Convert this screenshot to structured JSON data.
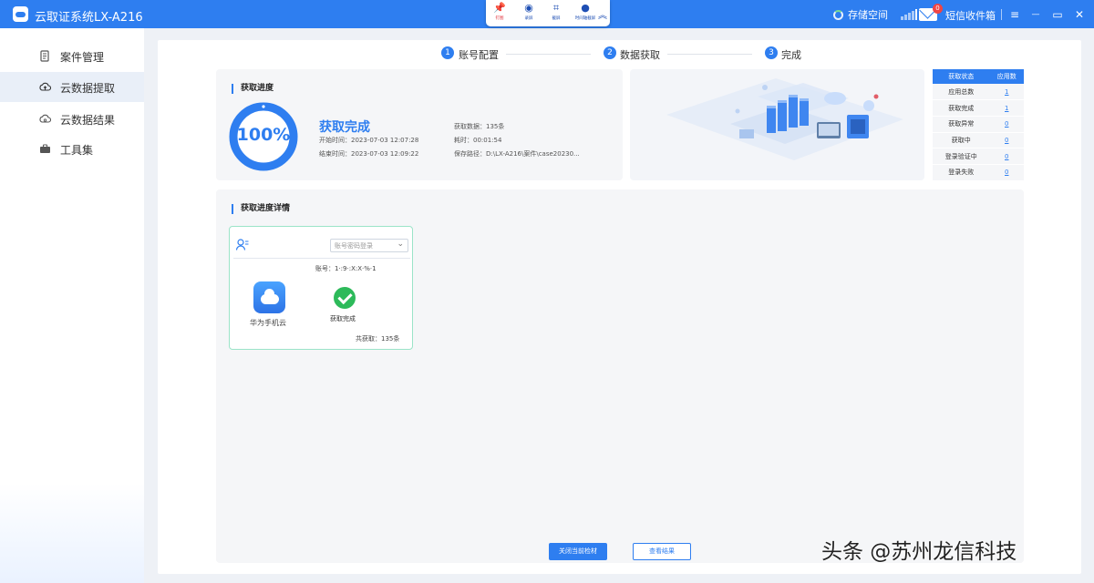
{
  "titlebar": {
    "app_title": "云取证系统LX-A216",
    "capture_tools": [
      {
        "label": "钉图",
        "icon": "pin-icon"
      },
      {
        "label": "录屏",
        "icon": "record-icon"
      },
      {
        "label": "截屏",
        "icon": "crop-icon"
      },
      {
        "label": "时间轴截屏",
        "icon": "clock-icon"
      }
    ],
    "storage_label": "存储空间",
    "sms_label": "短信收件箱",
    "sms_badge": "0",
    "menu_glyph": "≡",
    "minimize_glyph": "—",
    "maximize_glyph": "▭",
    "close_glyph": "✕"
  },
  "sidebar": {
    "items": [
      {
        "label": "案件管理",
        "icon": "document-icon",
        "active": false
      },
      {
        "label": "云数据提取",
        "icon": "cloud-upload-icon",
        "active": true
      },
      {
        "label": "云数据结果",
        "icon": "cloud-result-icon",
        "active": false
      },
      {
        "label": "工具集",
        "icon": "toolbox-icon",
        "active": false
      }
    ]
  },
  "steps": [
    {
      "num": "1",
      "label": "账号配置"
    },
    {
      "num": "2",
      "label": "数据获取"
    },
    {
      "num": "3",
      "label": "完成"
    }
  ],
  "progress": {
    "section_title": "获取进度",
    "percent": "100%",
    "percent_value": 1.0,
    "status": "获取完成",
    "start_time": "开始时间：2023-07-03 12:07:28",
    "end_time": "结束时间：2023-07-03 12:09:22",
    "data_count": "获取数据：135条",
    "duration": "耗时：00:01:54",
    "save_path": "保存路径：D:\\LX-A216\\案件\\case20230..."
  },
  "status_table": {
    "headers": [
      "获取状态",
      "应用数"
    ],
    "rows": [
      {
        "state": "应用总数",
        "count": "1"
      },
      {
        "state": "获取完成",
        "count": "1"
      },
      {
        "state": "获取异常",
        "count": "0"
      },
      {
        "state": "获取中",
        "count": "0"
      },
      {
        "state": "登录验证中",
        "count": "0"
      },
      {
        "state": "登录失败",
        "count": "0"
      }
    ]
  },
  "detail": {
    "section_title": "获取进度详情",
    "card": {
      "login_mode": "账号密码登录",
      "account": "账号：1·:9·:X:X·%·1",
      "app_name": "华为手机云",
      "status": "获取完成",
      "total": "共获取：135条"
    }
  },
  "buttons": {
    "close_case": "关闭当前检材",
    "view_result": "查看结果"
  },
  "watermark": "头条 @苏州龙信科技",
  "colors": {
    "accent": "#2e7ef0",
    "success": "#2dba5a",
    "badge": "#f04545"
  }
}
